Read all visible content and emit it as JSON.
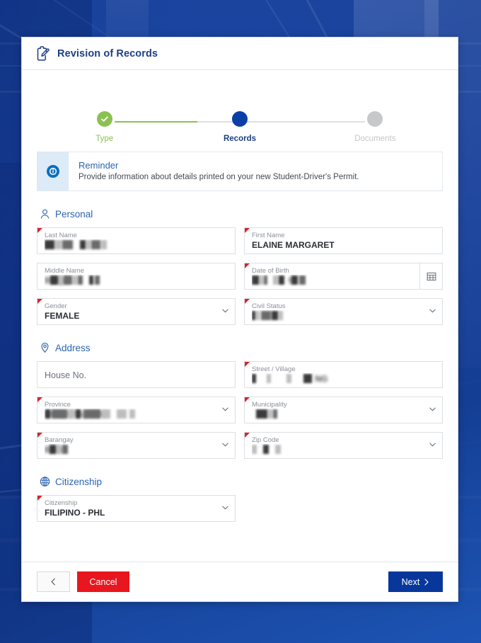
{
  "header": {
    "title": "Revision of Records",
    "icon": "clipboard-edit-icon"
  },
  "stepper": {
    "steps": [
      {
        "label": "Type",
        "state": "done"
      },
      {
        "label": "Records",
        "state": "active"
      },
      {
        "label": "Documents",
        "state": "todo"
      }
    ],
    "colors": {
      "done": "#8cc152",
      "active": "#0a3fa8",
      "todo": "#c6c8cc"
    }
  },
  "reminder": {
    "icon": "info-circle-icon",
    "title": "Reminder",
    "description": "Provide information about details printed on your new Student-Driver's Permit."
  },
  "sections": [
    {
      "id": "personal",
      "icon": "person-icon",
      "title": "Personal",
      "fields": [
        {
          "name": "last-name",
          "label": "Last Name",
          "value": "",
          "redacted": true,
          "required": true,
          "type": "text"
        },
        {
          "name": "first-name",
          "label": "First Name",
          "value": "ELAINE MARGARET",
          "redacted": false,
          "required": true,
          "type": "text"
        },
        {
          "name": "middle-name",
          "label": "Middle Name",
          "value": "",
          "redacted": true,
          "required": false,
          "type": "text"
        },
        {
          "name": "date-of-birth",
          "label": "Date of Birth",
          "value": "",
          "redacted": true,
          "required": true,
          "type": "date"
        },
        {
          "name": "gender",
          "label": "Gender",
          "value": "FEMALE",
          "redacted": false,
          "required": true,
          "type": "select"
        },
        {
          "name": "civil-status",
          "label": "Civil Status",
          "value": "",
          "redacted": true,
          "required": true,
          "type": "select"
        }
      ]
    },
    {
      "id": "address",
      "icon": "location-pin-icon",
      "title": "Address",
      "fields": [
        {
          "name": "house-no",
          "label": "",
          "value": "",
          "placeholder": "House No.",
          "redacted": false,
          "required": false,
          "type": "text"
        },
        {
          "name": "street-village",
          "label": "Street / Village",
          "value": "",
          "redacted": true,
          "required": true,
          "type": "text"
        },
        {
          "name": "province",
          "label": "Province",
          "value": "",
          "redacted": true,
          "required": true,
          "type": "select"
        },
        {
          "name": "municipality",
          "label": "Municipality",
          "value": "",
          "redacted": true,
          "required": true,
          "type": "select"
        },
        {
          "name": "barangay",
          "label": "Barangay",
          "value": "",
          "redacted": true,
          "required": true,
          "type": "select"
        },
        {
          "name": "zip-code",
          "label": "Zip Code",
          "value": "",
          "redacted": true,
          "required": true,
          "type": "select"
        }
      ]
    },
    {
      "id": "citizenship",
      "icon": "globe-icon",
      "title": "Citizenship",
      "fields": [
        {
          "name": "citizenship",
          "label": "Citizenship",
          "value": "FILIPINO - PHL",
          "redacted": false,
          "required": true,
          "type": "select"
        }
      ]
    }
  ],
  "footer": {
    "back_label": "",
    "back_icon": "chevron-left-icon",
    "cancel_label": "Cancel",
    "next_label": "Next",
    "next_icon": "chevron-right-icon",
    "colors": {
      "cancel": "#e8161f",
      "next": "#08379b"
    }
  }
}
